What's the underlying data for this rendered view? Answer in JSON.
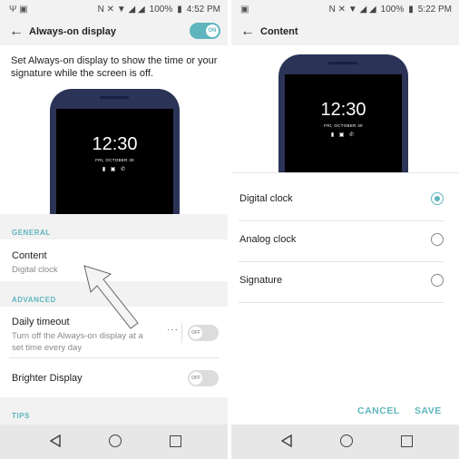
{
  "left": {
    "status": {
      "left_icons": "Ψ ▣",
      "right_icons": "N ✕ ▼ ◢ ◢",
      "battery": "100%",
      "time": "4:52 PM"
    },
    "appbar": {
      "title": "Always-on display",
      "toggle_label": "ON"
    },
    "description": "Set Always-on display to show the time or your signature while the screen is off.",
    "preview": {
      "time": "12:30",
      "date": "FRI, OCTOBER 30",
      "icons": "▮ ▣ ✆"
    },
    "sections": {
      "general": "GENERAL",
      "advanced": "ADVANCED",
      "tips": "TIPS"
    },
    "content_row": {
      "title": "Content",
      "subtitle": "Digital clock"
    },
    "daily_timeout": {
      "title": "Daily timeout",
      "subtitle": "Turn off the Always-on display at a set time every day",
      "dots": "···",
      "toggle_label": "OFF"
    },
    "brighter_display": {
      "title": "Brighter Display",
      "toggle_label": "OFF"
    }
  },
  "right": {
    "status": {
      "left_icons": "▣",
      "right_icons": "N ✕ ▼ ◢ ◢",
      "battery": "100%",
      "time": "5:22 PM"
    },
    "appbar": {
      "title": "Content"
    },
    "preview": {
      "time": "12:30",
      "date": "FRI, OCTOBER 30",
      "icons": "▮ ▣ ✆"
    },
    "options": [
      {
        "label": "Digital clock",
        "selected": true
      },
      {
        "label": "Analog clock",
        "selected": false
      },
      {
        "label": "Signature",
        "selected": false
      }
    ],
    "buttons": {
      "cancel": "CANCEL",
      "save": "SAVE"
    }
  },
  "colors": {
    "accent": "#5eb5bd",
    "phone_body": "#2b3356"
  }
}
